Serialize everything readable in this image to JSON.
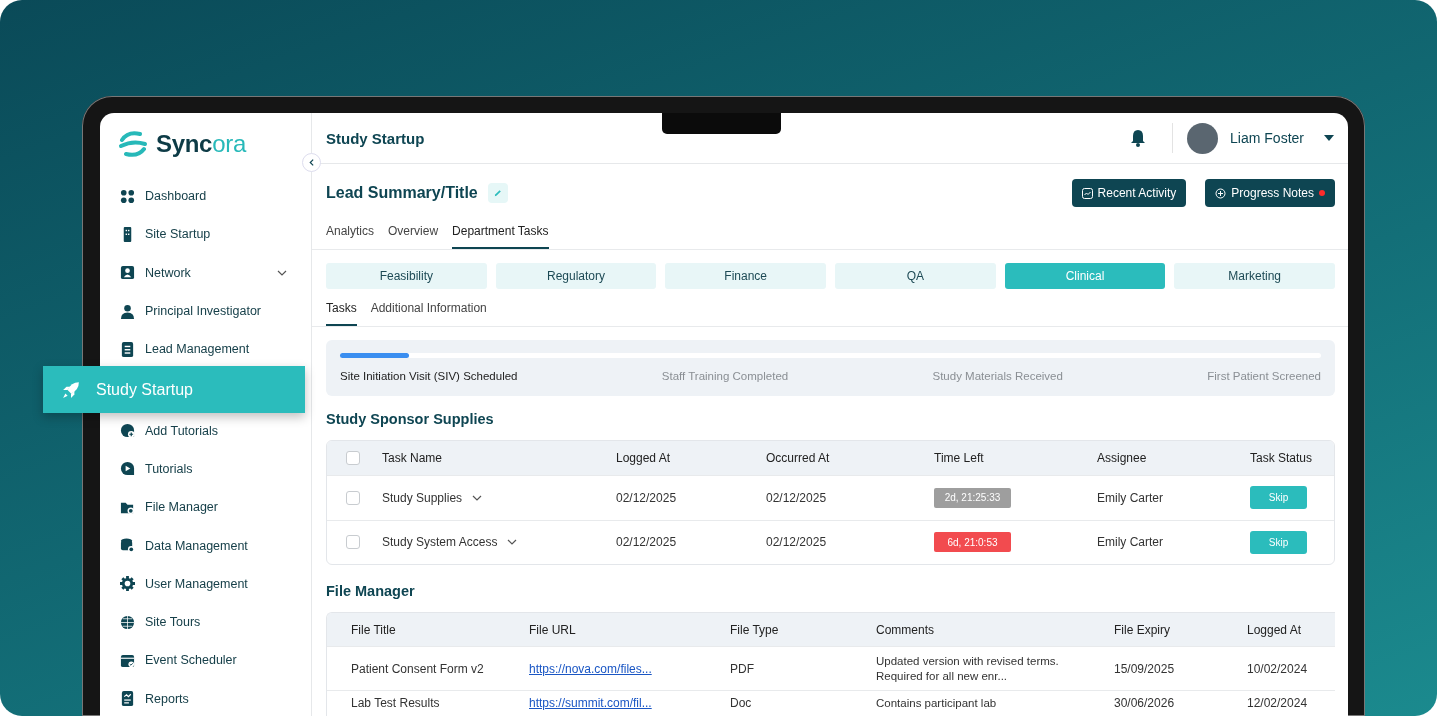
{
  "logo": {
    "text": "**Sync**ora"
  },
  "sidebar": {
    "items": [
      {
        "label": "Dashboard",
        "selected": false
      },
      {
        "label": "Site Startup",
        "selected": false
      },
      {
        "label": "Network",
        "selected": false,
        "expanded": false
      },
      {
        "label": "Principal Investigator",
        "selected": false
      },
      {
        "label": "Lead Management",
        "selected": false
      },
      {
        "label": "Study Startup",
        "selected": true
      },
      {
        "label": "Add Tutorials",
        "selected": false
      },
      {
        "label": "Tutorials",
        "selected": false
      },
      {
        "label": "File Manager",
        "selected": false
      },
      {
        "label": "Data Management",
        "selected": false
      },
      {
        "label": "User Management",
        "selected": false
      },
      {
        "label": "Site Tours",
        "selected": false
      },
      {
        "label": "Event Scheduler",
        "selected": false
      },
      {
        "label": "Reports",
        "selected": false
      }
    ]
  },
  "header": {
    "title": "Study Startup",
    "user": {
      "name": "Liam Foster"
    }
  },
  "lead": {
    "title": "Lead Summary/Title"
  },
  "actions": [
    {
      "label": "Recent Activity",
      "notification": false
    },
    {
      "label": "Progress Notes",
      "notification": true
    }
  ],
  "tabs": [
    {
      "label": "Analytics",
      "selected": false
    },
    {
      "label": "Overview",
      "selected": false
    },
    {
      "label": "Department Tasks",
      "selected": true
    }
  ],
  "departments": [
    {
      "label": "Feasibility",
      "selected": false
    },
    {
      "label": "Regulatory",
      "selected": false
    },
    {
      "label": "Finance",
      "selected": false
    },
    {
      "label": "QA",
      "selected": false
    },
    {
      "label": "Clinical",
      "selected": true
    },
    {
      "label": "Marketing",
      "selected": false
    }
  ],
  "subtabs": [
    {
      "label": "Tasks",
      "selected": true
    },
    {
      "label": "Additional Information",
      "selected": false
    }
  ],
  "progress": {
    "level": 0.07,
    "steps": [
      {
        "label": "Site Initiation Visit (SIV) Scheduled",
        "completed": true
      },
      {
        "label": "Staff Training Completed",
        "completed": false
      },
      {
        "label": "Study Materials Received",
        "completed": false
      },
      {
        "label": "First Patient Screened",
        "completed": false
      }
    ]
  },
  "sponsor_supplies": {
    "title": "Study Sponsor Supplies",
    "all_checked": false,
    "columns": [
      "Task Name",
      "Logged At",
      "Occurred At",
      "Time Left",
      "Assignee",
      "Task Status"
    ],
    "rows": [
      {
        "checked": false,
        "task": "Study Supplies",
        "logged_at": "02/12/2025",
        "occurred_at": "02/12/2025",
        "time_left": "2d, 21:25:33",
        "color": "#9e9e9e",
        "assignee": "Emily Carter",
        "status": "Skip"
      },
      {
        "checked": false,
        "task": "Study System Access",
        "logged_at": "02/12/2025",
        "occurred_at": "02/12/2025",
        "time_left": "6d, 21:0:53",
        "color": "#f24b4f",
        "assignee": "Emily Carter",
        "status": "Skip"
      }
    ]
  },
  "file_manager": {
    "title": "File Manager",
    "columns": [
      "File Title",
      "File URL",
      "File Type",
      "Comments",
      "File Expiry",
      "Logged At"
    ],
    "rows": [
      {
        "title": "Patient Consent Form v2",
        "url": "https://nova.com/files...",
        "type": "PDF",
        "comments": "Updated version with revised terms. Required for all new enr...",
        "expiry": "15/09/2025",
        "logged_at": "10/02/2024"
      },
      {
        "title": "Lab Test Results",
        "url": "https://summit.com/fil...",
        "type": "Doc",
        "comments": "Contains participant lab",
        "expiry": "30/06/2026",
        "logged_at": "12/02/2024"
      }
    ]
  }
}
